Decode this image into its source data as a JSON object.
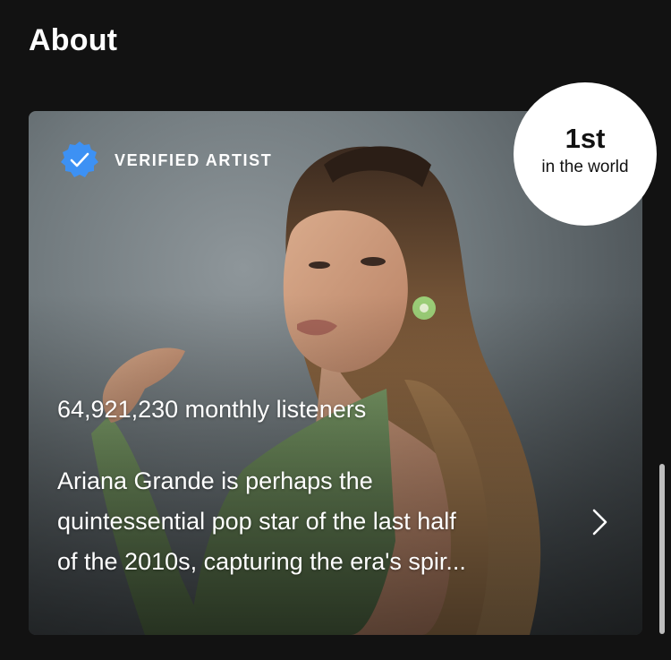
{
  "section": {
    "title": "About"
  },
  "card": {
    "verified_label": "VERIFIED ARTIST",
    "monthly_listeners": "64,921,230 monthly listeners",
    "bio_lines": [
      "Ariana Grande is perhaps the",
      "quintessential pop star of the last half",
      "of the 2010s, capturing the era's spir..."
    ],
    "photo_icon": "artist-photo",
    "chevron_icon": "chevron-right-icon"
  },
  "rank": {
    "value": "1st",
    "caption": "in the world"
  },
  "colors": {
    "background": "#121212",
    "verified_badge": "#3d91f4",
    "text": "#ffffff",
    "rank_badge": "#ffffff"
  }
}
